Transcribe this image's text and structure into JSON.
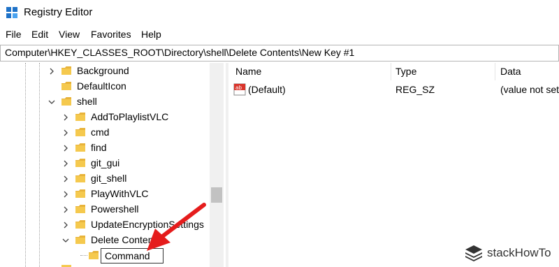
{
  "window": {
    "title": "Registry Editor"
  },
  "menu": [
    "File",
    "Edit",
    "View",
    "Favorites",
    "Help"
  ],
  "address": "Computer\\HKEY_CLASSES_ROOT\\Directory\\shell\\Delete Contents\\New Key #1",
  "tree": {
    "items": [
      {
        "label": "Background"
      },
      {
        "label": "DefaultIcon"
      },
      {
        "label": "shell"
      },
      {
        "label": "AddToPlaylistVLC"
      },
      {
        "label": "cmd"
      },
      {
        "label": "find"
      },
      {
        "label": "git_gui"
      },
      {
        "label": "git_shell"
      },
      {
        "label": "PlayWithVLC"
      },
      {
        "label": "Powershell"
      },
      {
        "label": "UpdateEncryptionSettings"
      },
      {
        "label": "Delete Contents"
      }
    ],
    "editing_value": "Command"
  },
  "list": {
    "headers": {
      "name": "Name",
      "type": "Type",
      "data": "Data"
    },
    "rows": [
      {
        "name": "(Default)",
        "type": "REG_SZ",
        "data": "(value not set)"
      }
    ]
  },
  "watermark": "stackHowTo",
  "colors": {
    "folder": "#e8b33a",
    "arrow": "#e51c1c",
    "icon_blue": "#1e72c8"
  }
}
